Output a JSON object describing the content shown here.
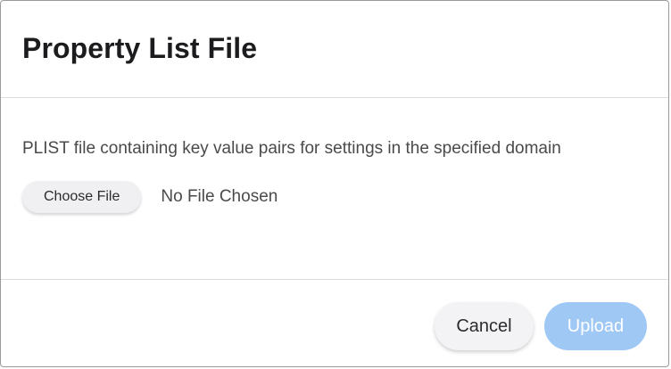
{
  "dialog": {
    "title": "Property List File",
    "description": "PLIST file containing key value pairs for settings in the specified domain",
    "file_input": {
      "button_label": "Choose File",
      "status": "No File Chosen"
    },
    "footer": {
      "cancel_label": "Cancel",
      "upload_label": "Upload",
      "upload_enabled": false
    }
  },
  "colors": {
    "upload_disabled_bg": "#9fc8f5",
    "secondary_button_bg": "#f3f3f6",
    "text_primary": "#1c1c1e",
    "text_secondary": "#4a4a4a"
  }
}
